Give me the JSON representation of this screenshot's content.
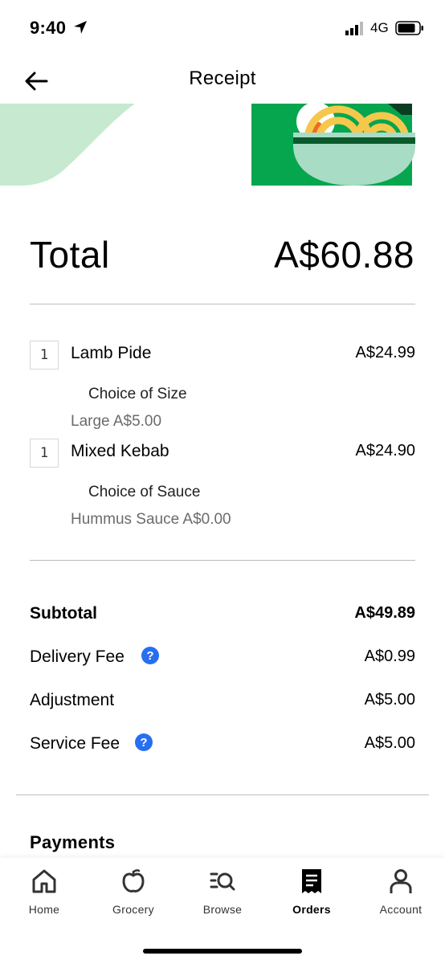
{
  "status_bar": {
    "time": "9:40",
    "network": "4G"
  },
  "header": {
    "title": "Receipt"
  },
  "total": {
    "label": "Total",
    "value": "A$60.88"
  },
  "items": [
    {
      "qty": "1",
      "name": "Lamb Pide",
      "price": "A$24.99",
      "option_title": "Choice of Size",
      "option_value": "Large A$5.00"
    },
    {
      "qty": "1",
      "name": "Mixed Kebab",
      "price": "A$24.90",
      "option_title": "Choice of Sauce",
      "option_value": "Hummus Sauce A$0.00"
    }
  ],
  "fees": {
    "subtotal": {
      "label": "Subtotal",
      "value": "A$49.89"
    },
    "delivery": {
      "label": "Delivery Fee",
      "value": "A$0.99"
    },
    "adjustment": {
      "label": "Adjustment",
      "value": "A$5.00"
    },
    "service": {
      "label": "Service Fee",
      "value": "A$5.00"
    },
    "help_glyph": "?"
  },
  "payments": {
    "title": "Payments"
  },
  "tabs": [
    {
      "label": "Home",
      "icon": "home-icon"
    },
    {
      "label": "Grocery",
      "icon": "apple-icon"
    },
    {
      "label": "Browse",
      "icon": "browse-icon"
    },
    {
      "label": "Orders",
      "icon": "receipt-icon"
    },
    {
      "label": "Account",
      "icon": "person-icon"
    }
  ],
  "colors": {
    "accent_green": "#06a64f",
    "light_green": "#c6e9cf",
    "bowl_green": "#a8dcc4",
    "help_blue": "#276ef1",
    "noodle_yellow": "#f5c84c"
  }
}
